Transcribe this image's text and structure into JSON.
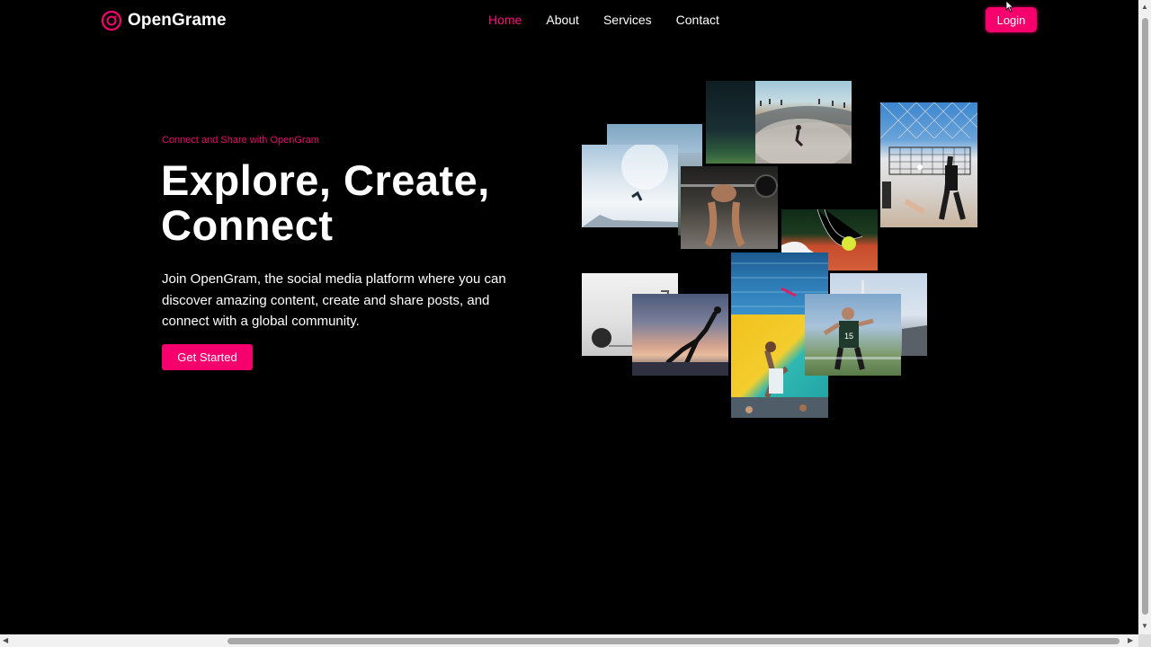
{
  "brand": {
    "name": "OpenGrame",
    "icon": "camera-ring-icon",
    "accent": "#f5006d"
  },
  "nav": {
    "items": [
      {
        "label": "Home",
        "active": true
      },
      {
        "label": "About",
        "active": false
      },
      {
        "label": "Services",
        "active": false
      },
      {
        "label": "Contact",
        "active": false
      }
    ],
    "login_label": "Login"
  },
  "hero": {
    "eyebrow": "Connect and Share with OpenGram",
    "title_line1": "Explore, Create,",
    "title_line2": "Connect",
    "description": "Join OpenGram, the social media platform where you can discover amazing content, create and share posts, and connect with a global community.",
    "cta_label": "Get Started"
  },
  "collage": {
    "photos": [
      "skateboard-jump-photo",
      "night-field-photo",
      "skatepark-photo",
      "volleyball-photo",
      "mountain-snow-jump-photo",
      "weightlifting-photo",
      "tennis-ball-photo",
      "basketball-photo",
      "swimming-pool-photo",
      "yoga-sunset-photo",
      "climbing-wall-photo",
      "soccer-player-photo",
      "stadium-photo"
    ]
  }
}
